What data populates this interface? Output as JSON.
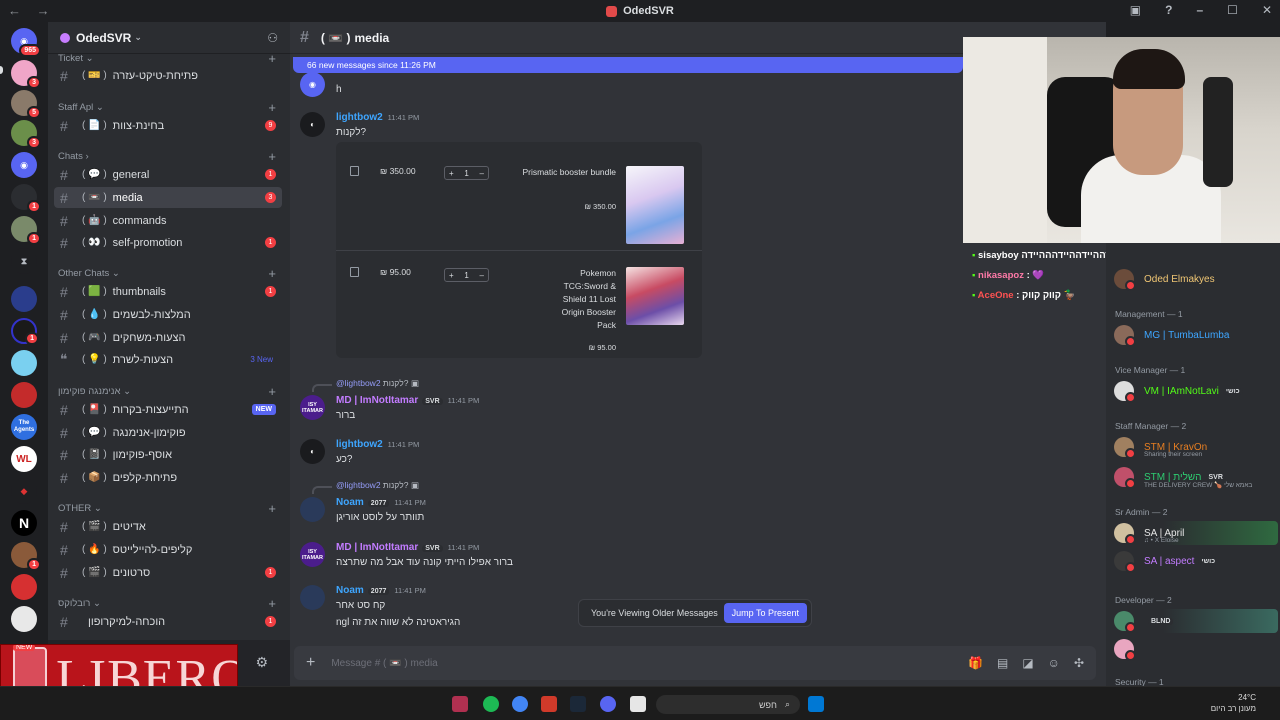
{
  "window": {
    "title": "OdedSVR"
  },
  "server": {
    "name": "OdedSVR"
  },
  "guild_badges": [
    "965",
    "3",
    "5",
    "3",
    "1",
    "1",
    "1",
    "1",
    "19",
    "1",
    "1",
    "1"
  ],
  "guild_labels": {
    "agents_top": "The",
    "agents_bottom": "Agents",
    "wl": "WL",
    "n": "N"
  },
  "categories": [
    {
      "label": "Ticket",
      "chevron": "⌄"
    },
    {
      "label": "Staff Apl",
      "chevron": "⌄"
    },
    {
      "label": "Chats",
      "chevron": "›"
    },
    {
      "label": "Other Chats",
      "chevron": "⌄"
    },
    {
      "label": "אנימנגה פוקימון",
      "chevron": "⌄"
    },
    {
      "label": "OTHER",
      "chevron": "⌄"
    },
    {
      "label": "רובלוקס",
      "chevron": "⌄"
    }
  ],
  "channels": [
    {
      "emoji": "( 🎫 )",
      "name": "פתיחת-טיקט-עזרה",
      "badge": ""
    },
    {
      "emoji": "( 📄 )",
      "name": "בחינת-צוות",
      "badge": "9"
    },
    {
      "emoji": "( 💬 )",
      "name": "general",
      "badge": "1"
    },
    {
      "emoji": "( 📼 )",
      "name": "media",
      "badge": "3"
    },
    {
      "emoji": "( 🤖 )",
      "name": "commands",
      "badge": ""
    },
    {
      "emoji": "( 👀 )",
      "name": "self-promotion",
      "badge": "1"
    },
    {
      "emoji": "( 🟩 )",
      "name": "thumbnails",
      "badge": "1"
    },
    {
      "emoji": "( 💧 )",
      "name": "המלצות-לבשמים",
      "badge": ""
    },
    {
      "emoji": "( 🎮 )",
      "name": "הצעות-משחקים",
      "badge": ""
    },
    {
      "emoji": "( 💡 )",
      "name": "הצעות-לשרת",
      "badge": "3 New"
    },
    {
      "emoji": "( 🎴 )",
      "name": "התייעצות-בקרות",
      "badge": "NEW"
    },
    {
      "emoji": "( 💬 )",
      "name": "פוקימון-אנימנגה",
      "badge": ""
    },
    {
      "emoji": "( 📓 )",
      "name": "אוסף-פוקימון",
      "badge": ""
    },
    {
      "emoji": "( 📦 )",
      "name": "פתיחת-קלפים",
      "badge": ""
    },
    {
      "emoji": "( 🎬 )",
      "name": "אדיטים",
      "badge": ""
    },
    {
      "emoji": "( 🔥 )",
      "name": "קליפים-להיילייטס",
      "badge": ""
    },
    {
      "emoji": "( 🎬 )",
      "name": "סרטונים",
      "badge": "1"
    },
    {
      "emoji": "",
      "name": "הוכחה-למיקרופון",
      "badge": "1"
    }
  ],
  "ad": {
    "text": "LIBERO",
    "tag": "NEW"
  },
  "channel_header": {
    "emoji": "( 📼 )",
    "name": "media"
  },
  "banner": "66 new messages since 11:26 PM",
  "messages": {
    "m0": {
      "text": "h"
    },
    "m1": {
      "author": "lightbow2",
      "time": "11:41 PM",
      "text": "לקנות?"
    },
    "m2": {
      "reply_ping": "@lightbow2",
      "reply_text": "לקנות?",
      "author": "MD | ImNotItamar",
      "tag": "SVR",
      "time": "11:41 PM",
      "text": "ברור",
      "avatar": "ISY ITAMAR"
    },
    "m3": {
      "author": "lightbow2",
      "time": "11:41 PM",
      "text": "כע?"
    },
    "m4": {
      "reply_ping": "@lightbow2",
      "reply_text": "לקנות?",
      "author": "Noam",
      "tag": "2077",
      "time": "11:41 PM",
      "text": "תוותר על לוסט אוריגן"
    },
    "m5": {
      "author": "MD | ImNotItamar",
      "tag": "SVR",
      "time": "11:41 PM",
      "text": "ברור אפילו הייתי קונה עוד אבל מה שתרצה",
      "avatar": "ISY ITAMAR"
    },
    "m6": {
      "author": "Noam",
      "tag": "2077",
      "time": "11:41 PM",
      "text1": "קח סט אחר",
      "text2": "ngl הגיראטינה לא שווה את זה"
    }
  },
  "cart": [
    {
      "price": "₪ 350.00",
      "qty": "1",
      "name": "Prismatic booster bundle",
      "subprice": "₪ 350.00"
    },
    {
      "price": "₪ 95.00",
      "qty": "1",
      "name": "Pokemon TCG:Sword & Shield 11 Lost Origin Booster Pack",
      "subprice": "₪ 95.00"
    }
  ],
  "toast": {
    "text": "You're Viewing Older Messages",
    "button": "Jump To Present"
  },
  "composer": {
    "placeholder": "Message # ( 📼 ) media"
  },
  "stream_chat": [
    {
      "user": "sisayboy",
      "text": "היידההיידה היידההיידההיידהההיידה :",
      "color": "#ffffff"
    },
    {
      "user": "nikasapoz",
      "text": ": 💜",
      "color": "#ff7aa8"
    },
    {
      "user": "AceOne",
      "text": ": קווק קווק 🦆",
      "color": "#ff5252"
    }
  ],
  "members": {
    "owner": "Oded Elmakyes",
    "management_cat": "Management — 1",
    "management": "MG | TumbaLumba",
    "vice_cat": "Vice Manager — 1",
    "vice": "VM | IAmNotLavi",
    "vice_tag": "כושי",
    "staff_cat": "Staff Manager — 2",
    "staff1": "STM | KravOn",
    "staff1_sub": "Sharing their screen",
    "staff2": "STM | השלית",
    "staff2_tag": "SVR",
    "staff2_sub": "THE DELIVERY CREW 🍗 באמא שלי",
    "sradmin_cat": "Sr Admin — 2",
    "sa1": "SA | April",
    "sa1_sub": "♫ • X Eloise",
    "sa2": "SA | aspect",
    "sa2_tag": "כושי",
    "dev_cat": "Developer — 2",
    "dev1_tag": "BLND",
    "security_cat": "Security — 1"
  },
  "taskbar": {
    "search": "חפש",
    "temp": "24°C",
    "weather": "מעונן רב היום",
    "badge": "3"
  }
}
